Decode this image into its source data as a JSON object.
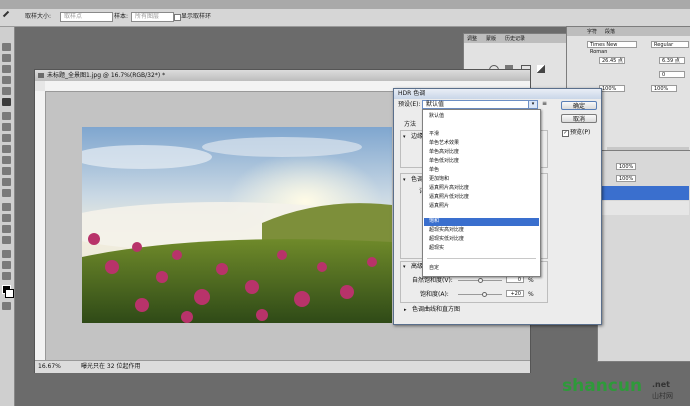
{
  "options_bar": {
    "sample_size_label": "取样大小:",
    "sample_size_value": "取样点",
    "sample_label": "样本:",
    "sample_value": "所有图层",
    "show_ring_label": "显示取样环"
  },
  "document": {
    "title": "未标题_全景图1.jpg @ 16.7%(RGB/32*) *",
    "zoom": "16.67%",
    "status_text": "曝光只在 32 位起作用"
  },
  "adjustments_panel": {
    "tabs": [
      "调整",
      "蒙版",
      "历史记录"
    ]
  },
  "character_panel": {
    "tabs": [
      "字符",
      "段落"
    ],
    "font_family": "Times New Roman",
    "font_style": "Regular",
    "size_value": "26.45 点",
    "leading_value": "6.39 点",
    "tracking_value": "0",
    "scale_value": "100%",
    "scale_v_value": "100%"
  },
  "layers_panel": {
    "opacity_value": "100%",
    "fill_value": "100%"
  },
  "hdr_dialog": {
    "title": "HDR 色调",
    "preset_label": "预设(E):",
    "preset_value": "默认值",
    "ok_label": "确定",
    "cancel_label": "取消",
    "preview_label": "预览(P)",
    "method_label": "方法",
    "edge_glow_label": "边缘",
    "tone_label": "色调",
    "detail_label": "详细",
    "advanced_label": "高级",
    "vibrance_label": "自然饱和度(V):",
    "vibrance_value": "0",
    "saturation_label": "饱和度(A):",
    "saturation_value": "+20",
    "percent": "%",
    "toning_curve_label": "色调曲线和直方图",
    "presets": [
      "默认值",
      "平滑",
      "单色艺术效果",
      "单色高对比度",
      "单色低对比度",
      "单色",
      "更加饱和",
      "逼真照片高对比度",
      "逼真照片低对比度",
      "逼真照片",
      "饱和",
      "超现实高对比度",
      "超现实低对比度",
      "超现实",
      "",
      "自定"
    ],
    "selected_preset_index": 10
  },
  "watermark": {
    "brand": "shancun",
    "domain": ".net",
    "chinese": "山村网"
  }
}
